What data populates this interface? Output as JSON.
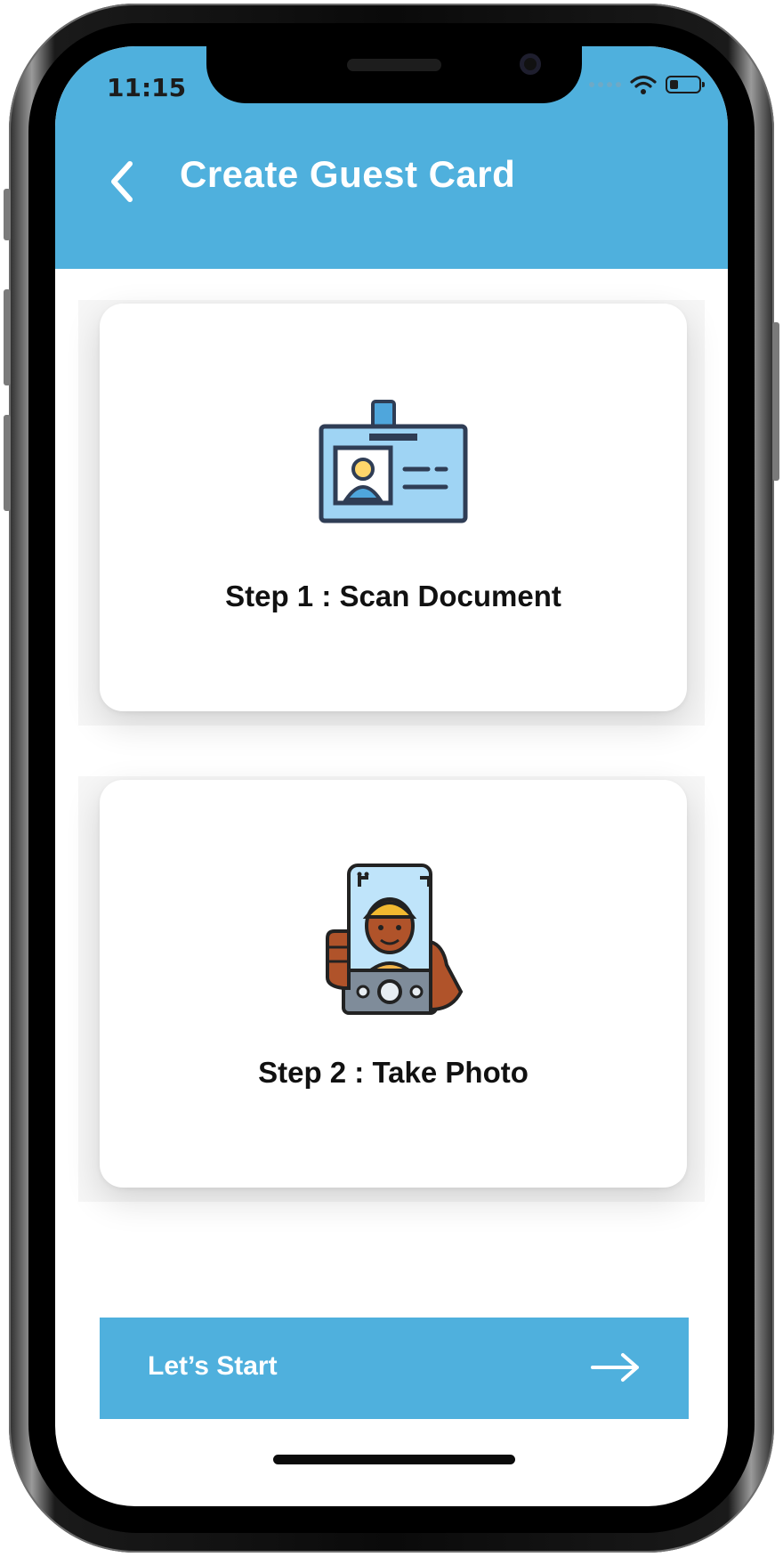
{
  "status_bar": {
    "time": "11:15",
    "wifi_icon": "wifi-icon",
    "battery_icon": "battery-icon"
  },
  "header": {
    "title": "Create Guest Card",
    "back_icon": "chevron-left-icon",
    "background_color": "#4fb0dd"
  },
  "steps": [
    {
      "label": "Step 1 : Scan Document",
      "icon": "id-card-icon"
    },
    {
      "label": "Step 2 : Take Photo",
      "icon": "selfie-camera-icon"
    }
  ],
  "start_button": {
    "label": "Let’s Start",
    "icon": "arrow-right-icon",
    "color": "#4fb0dd"
  }
}
